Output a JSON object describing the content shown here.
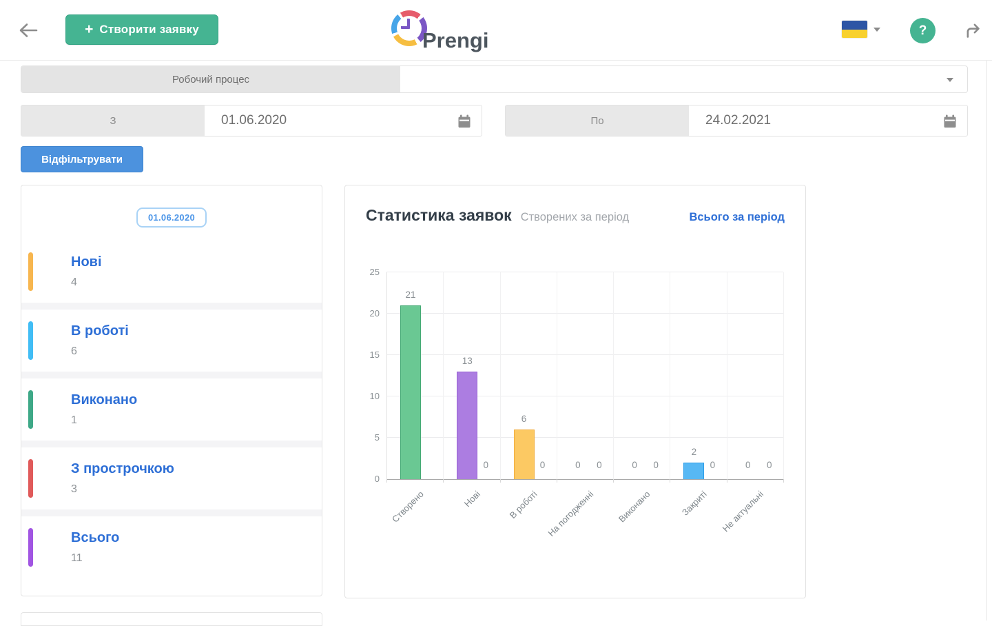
{
  "header": {
    "create_button": {
      "plus": "+",
      "label": "Створити заявку"
    },
    "logo_text": "Prengi",
    "help_label": "?"
  },
  "filters": {
    "workflow_label": "Робочий процес",
    "date_from": {
      "label": "З",
      "value": "01.06.2020"
    },
    "date_to": {
      "label": "По",
      "value": "24.02.2021"
    },
    "filter_button": "Відфільтрувати"
  },
  "summary": {
    "date_badge": "01.06.2020",
    "items": [
      {
        "label": "Нові",
        "value": "4",
        "color": "#F7B64F"
      },
      {
        "label": "В роботі",
        "value": "6",
        "color": "#41BDF5"
      },
      {
        "label": "Виконано",
        "value": "1",
        "color": "#3EA887"
      },
      {
        "label": "З прострочкою",
        "value": "3",
        "color": "#E05A5A"
      },
      {
        "label": "Всього",
        "value": "11",
        "color": "#A155E2"
      }
    ]
  },
  "stats": {
    "title": "Статистика заявок",
    "subtitle": "Створених за період",
    "link": "Всього за період"
  },
  "chart_data": {
    "type": "bar",
    "title": "Статистика заявок",
    "categories": [
      "Створено",
      "Нові",
      "В роботі",
      "На погодженні",
      "Виконано",
      "Закриті",
      "Не актуальні"
    ],
    "series": [
      {
        "name": "Створених за період",
        "values": [
          21,
          13,
          6,
          0,
          0,
          2,
          0
        ]
      },
      {
        "name": "Всього за період",
        "values": [
          null,
          0,
          0,
          0,
          0,
          0,
          0
        ]
      }
    ],
    "bar_colors": [
      {
        "fill": "#6AC893",
        "stroke": "#44A974"
      },
      {
        "fill": "#AC7DE1",
        "stroke": "#9760D4"
      },
      {
        "fill": "#FCC963",
        "stroke": "#F1AD3C"
      },
      null,
      null,
      {
        "fill": "#57B8F4",
        "stroke": "#2E9EE8"
      },
      null
    ],
    "ylim": [
      0,
      25
    ],
    "yticks": [
      0,
      5,
      10,
      15,
      20,
      25
    ],
    "grid": true,
    "legend": "none",
    "xlabel": "",
    "ylabel": ""
  },
  "colors": {
    "accent_green": "#45B492",
    "accent_blue": "#4C92DE",
    "link_blue": "#2E6FD6",
    "badge_blue": "#4D96E8",
    "flag_blue": "#2D55A5",
    "flag_yellow": "#F8D12E",
    "muted_text": "#8D9296"
  }
}
